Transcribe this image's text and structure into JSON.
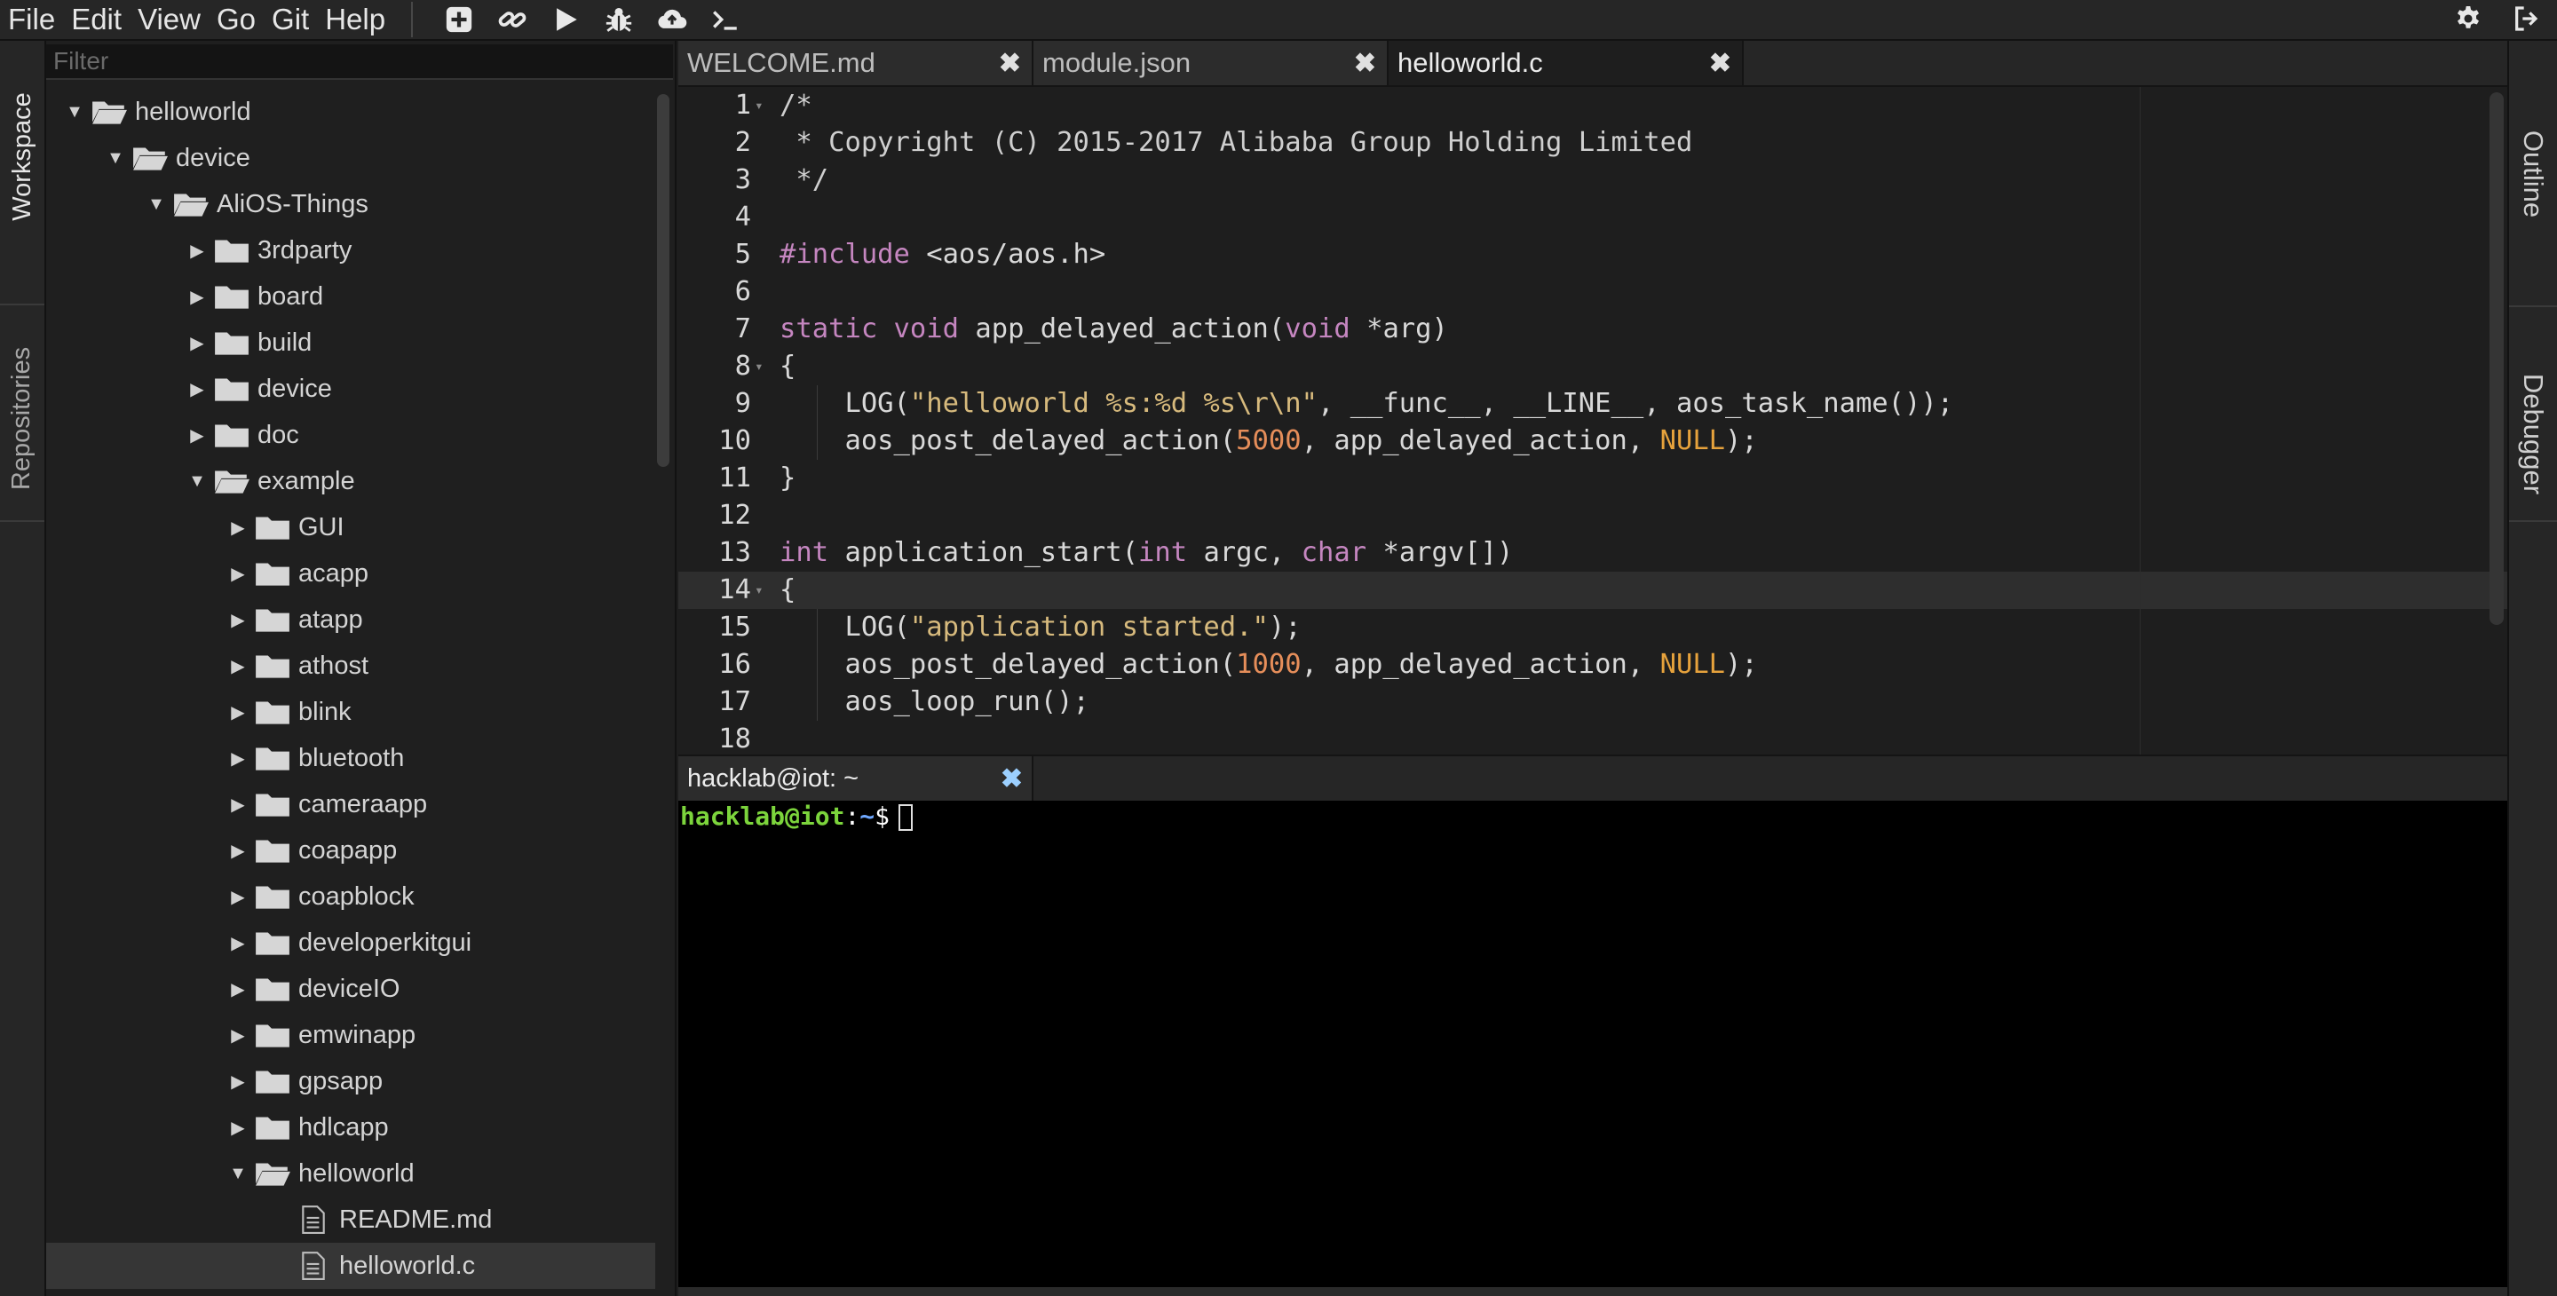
{
  "menubar": {
    "items": [
      "File",
      "Edit",
      "View",
      "Go",
      "Git",
      "Help"
    ],
    "tool_icons": [
      "add-file-icon",
      "link-icon",
      "run-icon",
      "debug-icon",
      "cloud-upload-icon",
      "terminal-icon"
    ],
    "right_icons": [
      "settings-icon",
      "logout-icon"
    ]
  },
  "left_rail": {
    "tabs": [
      "Workspace",
      "Repositories"
    ]
  },
  "right_rail": {
    "tabs": [
      "Outline",
      "Debugger"
    ]
  },
  "explorer": {
    "filter_placeholder": "Filter",
    "items": [
      {
        "label": "helloworld",
        "depth": 0,
        "type": "folder",
        "expanded": true
      },
      {
        "label": "device",
        "depth": 1,
        "type": "folder",
        "expanded": true
      },
      {
        "label": "AliOS-Things",
        "depth": 2,
        "type": "folder",
        "expanded": true
      },
      {
        "label": "3rdparty",
        "depth": 3,
        "type": "folder",
        "expanded": false
      },
      {
        "label": "board",
        "depth": 3,
        "type": "folder",
        "expanded": false
      },
      {
        "label": "build",
        "depth": 3,
        "type": "folder",
        "expanded": false
      },
      {
        "label": "device",
        "depth": 3,
        "type": "folder",
        "expanded": false
      },
      {
        "label": "doc",
        "depth": 3,
        "type": "folder",
        "expanded": false
      },
      {
        "label": "example",
        "depth": 3,
        "type": "folder",
        "expanded": true
      },
      {
        "label": "GUI",
        "depth": 4,
        "type": "folder",
        "expanded": false
      },
      {
        "label": "acapp",
        "depth": 4,
        "type": "folder",
        "expanded": false
      },
      {
        "label": "atapp",
        "depth": 4,
        "type": "folder",
        "expanded": false
      },
      {
        "label": "athost",
        "depth": 4,
        "type": "folder",
        "expanded": false
      },
      {
        "label": "blink",
        "depth": 4,
        "type": "folder",
        "expanded": false
      },
      {
        "label": "bluetooth",
        "depth": 4,
        "type": "folder",
        "expanded": false
      },
      {
        "label": "cameraapp",
        "depth": 4,
        "type": "folder",
        "expanded": false
      },
      {
        "label": "coapapp",
        "depth": 4,
        "type": "folder",
        "expanded": false
      },
      {
        "label": "coapblock",
        "depth": 4,
        "type": "folder",
        "expanded": false
      },
      {
        "label": "developerkitgui",
        "depth": 4,
        "type": "folder",
        "expanded": false
      },
      {
        "label": "deviceIO",
        "depth": 4,
        "type": "folder",
        "expanded": false
      },
      {
        "label": "emwinapp",
        "depth": 4,
        "type": "folder",
        "expanded": false
      },
      {
        "label": "gpsapp",
        "depth": 4,
        "type": "folder",
        "expanded": false
      },
      {
        "label": "hdlcapp",
        "depth": 4,
        "type": "folder",
        "expanded": false
      },
      {
        "label": "helloworld",
        "depth": 4,
        "type": "folder",
        "expanded": true
      },
      {
        "label": "README.md",
        "depth": 5,
        "type": "file"
      },
      {
        "label": "helloworld.c",
        "depth": 5,
        "type": "file",
        "selected": true
      }
    ]
  },
  "editor": {
    "tabs": [
      {
        "label": "WELCOME.md",
        "active": false
      },
      {
        "label": "module.json",
        "active": false
      },
      {
        "label": "helloworld.c",
        "active": true
      }
    ],
    "current_line": 14,
    "lines": [
      {
        "n": "1",
        "fold": true,
        "tokens": [
          [
            "c",
            "/*"
          ]
        ]
      },
      {
        "n": "2",
        "tokens": [
          [
            "c",
            " * Copyright (C) 2015-2017 Alibaba Group Holding Limited"
          ]
        ]
      },
      {
        "n": "3",
        "tokens": [
          [
            "c",
            " */"
          ]
        ]
      },
      {
        "n": "4",
        "tokens": []
      },
      {
        "n": "5",
        "tokens": [
          [
            "pp",
            "#include "
          ],
          [
            "",
            "<aos/aos.h>"
          ]
        ]
      },
      {
        "n": "6",
        "tokens": []
      },
      {
        "n": "7",
        "tokens": [
          [
            "kw",
            "static void "
          ],
          [
            "",
            "app_delayed_action("
          ],
          [
            "kw",
            "void "
          ],
          [
            "",
            "*arg)"
          ]
        ]
      },
      {
        "n": "8",
        "fold": true,
        "tokens": [
          [
            "",
            "{"
          ]
        ]
      },
      {
        "n": "9",
        "guide": true,
        "tokens": [
          [
            "",
            "    LOG("
          ],
          [
            "str",
            "\"helloworld %s:%d %s\\r\\n\""
          ],
          [
            "",
            ", __func__, __LINE__, aos_task_name());"
          ]
        ]
      },
      {
        "n": "10",
        "guide": true,
        "tokens": [
          [
            "",
            "    aos_post_delayed_action("
          ],
          [
            "num",
            "5000"
          ],
          [
            "",
            ", app_delayed_action, "
          ],
          [
            "nul",
            "NULL"
          ],
          [
            "",
            ");"
          ]
        ]
      },
      {
        "n": "11",
        "tokens": [
          [
            "",
            "}"
          ]
        ]
      },
      {
        "n": "12",
        "tokens": []
      },
      {
        "n": "13",
        "tokens": [
          [
            "kw",
            "int "
          ],
          [
            "",
            "application_start("
          ],
          [
            "kw",
            "int "
          ],
          [
            "",
            "argc, "
          ],
          [
            "kw",
            "char "
          ],
          [
            "",
            "*argv[])"
          ]
        ]
      },
      {
        "n": "14",
        "fold": true,
        "tokens": [
          [
            "",
            "{"
          ]
        ]
      },
      {
        "n": "15",
        "guide": true,
        "tokens": [
          [
            "",
            "    LOG("
          ],
          [
            "str",
            "\"application started.\""
          ],
          [
            "",
            ");"
          ]
        ]
      },
      {
        "n": "16",
        "guide": true,
        "tokens": [
          [
            "",
            "    aos_post_delayed_action("
          ],
          [
            "num",
            "1000"
          ],
          [
            "",
            ", app_delayed_action, "
          ],
          [
            "nul",
            "NULL"
          ],
          [
            "",
            ");"
          ]
        ]
      },
      {
        "n": "17",
        "guide": true,
        "tokens": [
          [
            "",
            "    aos_loop_run();"
          ]
        ]
      },
      {
        "n": "18",
        "tokens": []
      }
    ]
  },
  "terminal": {
    "tab_label": "hacklab@iot: ~",
    "prompt_user": "hacklab@iot",
    "prompt_colon": ":",
    "prompt_path": "~",
    "prompt_dollar": "$"
  },
  "colors": {
    "keyword": "#c586c0",
    "string": "#d7ba7d",
    "number": "#e68e5a",
    "null": "#e6a23c",
    "prompt_user": "#7cd43c",
    "prompt_path": "#6fa8ff"
  }
}
